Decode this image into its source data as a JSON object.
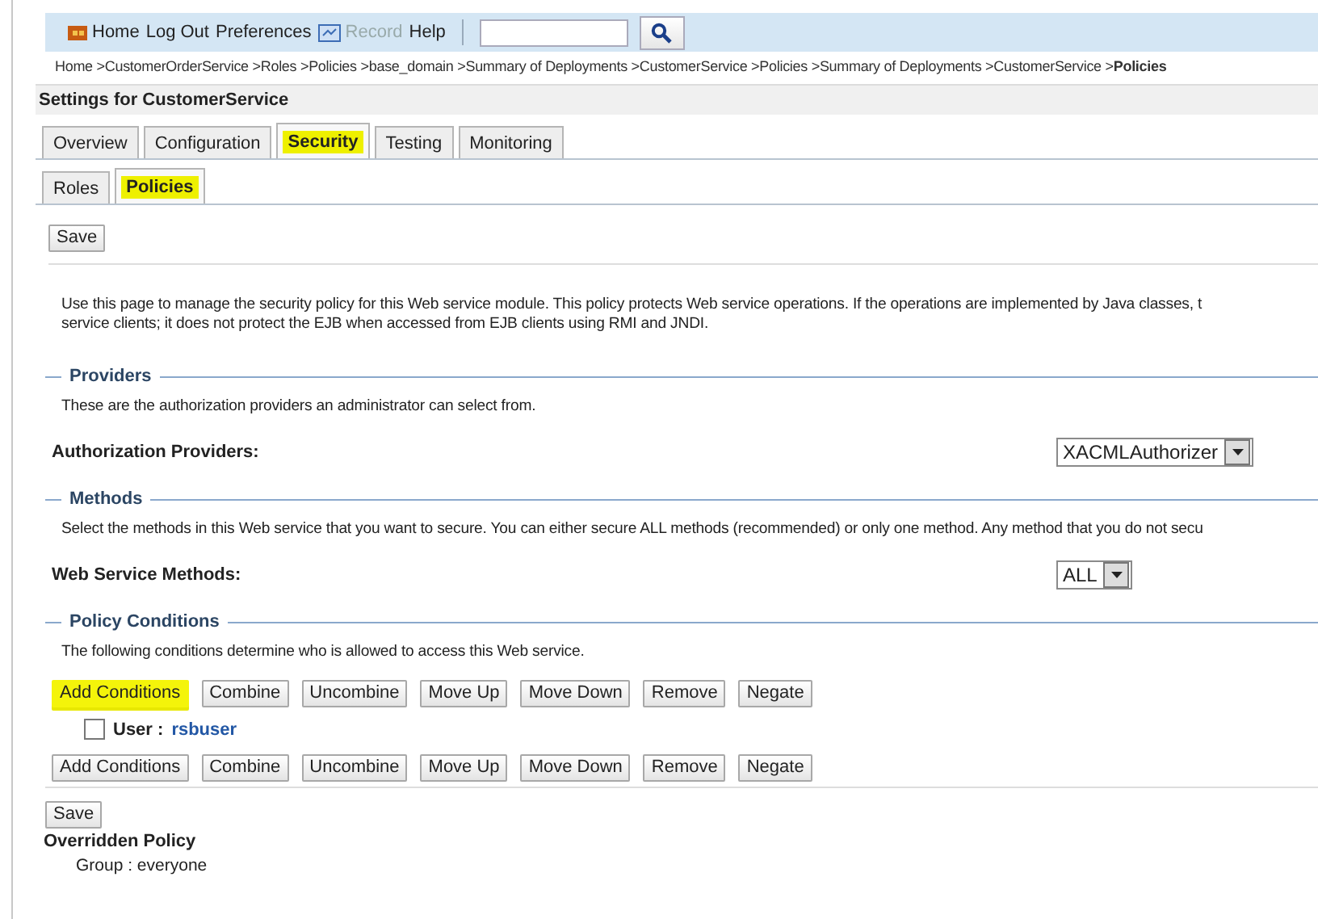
{
  "nav": {
    "items": [
      {
        "label": "Home",
        "kind": "home",
        "disabled": false
      },
      {
        "label": "Log Out",
        "kind": "link",
        "disabled": false
      },
      {
        "label": "Preferences",
        "kind": "link",
        "disabled": false
      },
      {
        "label": "Record",
        "kind": "record",
        "disabled": true
      },
      {
        "label": "Help",
        "kind": "link",
        "disabled": false
      }
    ]
  },
  "breadcrumb": [
    {
      "label": "Home >",
      "current": false
    },
    {
      "label": "CustomerOrderService >",
      "current": false
    },
    {
      "label": "Roles >",
      "current": false
    },
    {
      "label": "Policies >",
      "current": false
    },
    {
      "label": "base_domain >",
      "current": false
    },
    {
      "label": "Summary of Deployments >",
      "current": false
    },
    {
      "label": "CustomerService >",
      "current": false
    },
    {
      "label": "Policies >",
      "current": false
    },
    {
      "label": "Summary of Deployments >",
      "current": false
    },
    {
      "label": "CustomerService >",
      "current": false
    },
    {
      "label": "Policies",
      "current": true
    }
  ],
  "page_title": "Settings for CustomerService",
  "tabs": [
    {
      "label": "Overview",
      "selected": false,
      "highlighted": false
    },
    {
      "label": "Configuration",
      "selected": false,
      "highlighted": false
    },
    {
      "label": "Security",
      "selected": true,
      "highlighted": true
    },
    {
      "label": "Testing",
      "selected": false,
      "highlighted": false
    },
    {
      "label": "Monitoring",
      "selected": false,
      "highlighted": false
    }
  ],
  "subtabs": [
    {
      "label": "Roles",
      "selected": false,
      "highlighted": false
    },
    {
      "label": "Policies",
      "selected": true,
      "highlighted": true
    }
  ],
  "top_save": "Save",
  "description": [
    "Use this page to manage the security policy for this Web service module. This policy protects Web service operations. If the operations are implemented by Java classes, t",
    "service clients; it does not protect the EJB when accessed from EJB clients using RMI and JNDI."
  ],
  "sections": [
    {
      "kind": "select",
      "title": "Providers",
      "hint": "These are the authorization providers an administrator can select from.",
      "field_label": "Authorization Providers:",
      "value": "XACMLAuthorizer"
    },
    {
      "kind": "select",
      "title": "Methods",
      "hint": "Select the methods in this Web service that you want to secure. You can either secure ALL methods (recommended) or only one method. Any method that you do not secu",
      "field_label": "Web Service Methods:",
      "value": "ALL"
    },
    {
      "kind": "conditions",
      "title": "Policy Conditions",
      "hint": "The following conditions determine who is allowed to access this Web service.",
      "toolbar_top": [
        {
          "label": "Add Conditions",
          "highlighted": true
        },
        {
          "label": "Combine",
          "highlighted": false
        },
        {
          "label": "Uncombine",
          "highlighted": false
        },
        {
          "label": "Move Up",
          "highlighted": false
        },
        {
          "label": "Move Down",
          "highlighted": false
        },
        {
          "label": "Remove",
          "highlighted": false
        },
        {
          "label": "Negate",
          "highlighted": false
        }
      ],
      "conditions": [
        {
          "label": "User :",
          "value": "rsbuser",
          "checked": false
        }
      ],
      "toolbar_bottom": [
        {
          "label": "Add Conditions",
          "highlighted": false
        },
        {
          "label": "Combine",
          "highlighted": false
        },
        {
          "label": "Uncombine",
          "highlighted": false
        },
        {
          "label": "Move Up",
          "highlighted": false
        },
        {
          "label": "Move Down",
          "highlighted": false
        },
        {
          "label": "Remove",
          "highlighted": false
        },
        {
          "label": "Negate",
          "highlighted": false
        }
      ]
    }
  ],
  "bottom_save": "Save",
  "overridden": {
    "title": "Overridden Policy",
    "text": "Group : everyone"
  }
}
